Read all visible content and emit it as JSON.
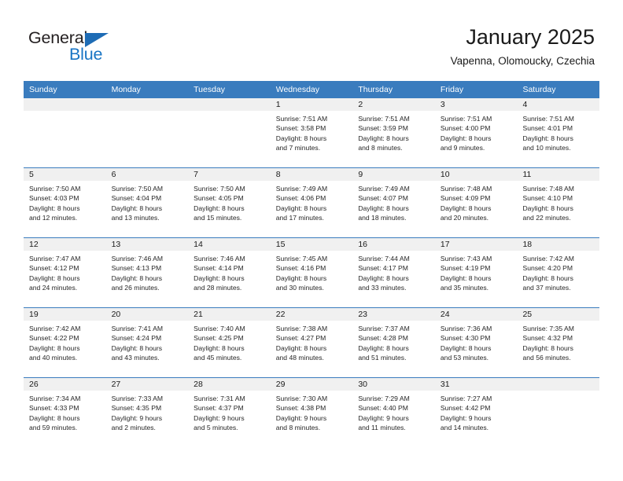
{
  "brand": {
    "name_part1": "General",
    "name_part2": "Blue",
    "color_dark": "#231f20",
    "color_blue": "#1874c4",
    "triangle_icon": "triangle-icon"
  },
  "header": {
    "title": "January 2025",
    "subtitle": "Vapenna, Olomoucky, Czechia"
  },
  "theme": {
    "header_band": "#3a7cbe",
    "day_strip": "#f0f0f0",
    "text": "#262626"
  },
  "weekdays": [
    "Sunday",
    "Monday",
    "Tuesday",
    "Wednesday",
    "Thursday",
    "Friday",
    "Saturday"
  ],
  "weeks": [
    [
      {
        "day": "",
        "empty": true,
        "sunrise": "",
        "sunset": "",
        "daylight1": "",
        "daylight2": ""
      },
      {
        "day": "",
        "empty": true,
        "sunrise": "",
        "sunset": "",
        "daylight1": "",
        "daylight2": ""
      },
      {
        "day": "",
        "empty": true,
        "sunrise": "",
        "sunset": "",
        "daylight1": "",
        "daylight2": ""
      },
      {
        "day": "1",
        "empty": false,
        "sunrise": "Sunrise: 7:51 AM",
        "sunset": "Sunset: 3:58 PM",
        "daylight1": "Daylight: 8 hours",
        "daylight2": "and 7 minutes."
      },
      {
        "day": "2",
        "empty": false,
        "sunrise": "Sunrise: 7:51 AM",
        "sunset": "Sunset: 3:59 PM",
        "daylight1": "Daylight: 8 hours",
        "daylight2": "and 8 minutes."
      },
      {
        "day": "3",
        "empty": false,
        "sunrise": "Sunrise: 7:51 AM",
        "sunset": "Sunset: 4:00 PM",
        "daylight1": "Daylight: 8 hours",
        "daylight2": "and 9 minutes."
      },
      {
        "day": "4",
        "empty": false,
        "sunrise": "Sunrise: 7:51 AM",
        "sunset": "Sunset: 4:01 PM",
        "daylight1": "Daylight: 8 hours",
        "daylight2": "and 10 minutes."
      }
    ],
    [
      {
        "day": "5",
        "empty": false,
        "sunrise": "Sunrise: 7:50 AM",
        "sunset": "Sunset: 4:03 PM",
        "daylight1": "Daylight: 8 hours",
        "daylight2": "and 12 minutes."
      },
      {
        "day": "6",
        "empty": false,
        "sunrise": "Sunrise: 7:50 AM",
        "sunset": "Sunset: 4:04 PM",
        "daylight1": "Daylight: 8 hours",
        "daylight2": "and 13 minutes."
      },
      {
        "day": "7",
        "empty": false,
        "sunrise": "Sunrise: 7:50 AM",
        "sunset": "Sunset: 4:05 PM",
        "daylight1": "Daylight: 8 hours",
        "daylight2": "and 15 minutes."
      },
      {
        "day": "8",
        "empty": false,
        "sunrise": "Sunrise: 7:49 AM",
        "sunset": "Sunset: 4:06 PM",
        "daylight1": "Daylight: 8 hours",
        "daylight2": "and 17 minutes."
      },
      {
        "day": "9",
        "empty": false,
        "sunrise": "Sunrise: 7:49 AM",
        "sunset": "Sunset: 4:07 PM",
        "daylight1": "Daylight: 8 hours",
        "daylight2": "and 18 minutes."
      },
      {
        "day": "10",
        "empty": false,
        "sunrise": "Sunrise: 7:48 AM",
        "sunset": "Sunset: 4:09 PM",
        "daylight1": "Daylight: 8 hours",
        "daylight2": "and 20 minutes."
      },
      {
        "day": "11",
        "empty": false,
        "sunrise": "Sunrise: 7:48 AM",
        "sunset": "Sunset: 4:10 PM",
        "daylight1": "Daylight: 8 hours",
        "daylight2": "and 22 minutes."
      }
    ],
    [
      {
        "day": "12",
        "empty": false,
        "sunrise": "Sunrise: 7:47 AM",
        "sunset": "Sunset: 4:12 PM",
        "daylight1": "Daylight: 8 hours",
        "daylight2": "and 24 minutes."
      },
      {
        "day": "13",
        "empty": false,
        "sunrise": "Sunrise: 7:46 AM",
        "sunset": "Sunset: 4:13 PM",
        "daylight1": "Daylight: 8 hours",
        "daylight2": "and 26 minutes."
      },
      {
        "day": "14",
        "empty": false,
        "sunrise": "Sunrise: 7:46 AM",
        "sunset": "Sunset: 4:14 PM",
        "daylight1": "Daylight: 8 hours",
        "daylight2": "and 28 minutes."
      },
      {
        "day": "15",
        "empty": false,
        "sunrise": "Sunrise: 7:45 AM",
        "sunset": "Sunset: 4:16 PM",
        "daylight1": "Daylight: 8 hours",
        "daylight2": "and 30 minutes."
      },
      {
        "day": "16",
        "empty": false,
        "sunrise": "Sunrise: 7:44 AM",
        "sunset": "Sunset: 4:17 PM",
        "daylight1": "Daylight: 8 hours",
        "daylight2": "and 33 minutes."
      },
      {
        "day": "17",
        "empty": false,
        "sunrise": "Sunrise: 7:43 AM",
        "sunset": "Sunset: 4:19 PM",
        "daylight1": "Daylight: 8 hours",
        "daylight2": "and 35 minutes."
      },
      {
        "day": "18",
        "empty": false,
        "sunrise": "Sunrise: 7:42 AM",
        "sunset": "Sunset: 4:20 PM",
        "daylight1": "Daylight: 8 hours",
        "daylight2": "and 37 minutes."
      }
    ],
    [
      {
        "day": "19",
        "empty": false,
        "sunrise": "Sunrise: 7:42 AM",
        "sunset": "Sunset: 4:22 PM",
        "daylight1": "Daylight: 8 hours",
        "daylight2": "and 40 minutes."
      },
      {
        "day": "20",
        "empty": false,
        "sunrise": "Sunrise: 7:41 AM",
        "sunset": "Sunset: 4:24 PM",
        "daylight1": "Daylight: 8 hours",
        "daylight2": "and 43 minutes."
      },
      {
        "day": "21",
        "empty": false,
        "sunrise": "Sunrise: 7:40 AM",
        "sunset": "Sunset: 4:25 PM",
        "daylight1": "Daylight: 8 hours",
        "daylight2": "and 45 minutes."
      },
      {
        "day": "22",
        "empty": false,
        "sunrise": "Sunrise: 7:38 AM",
        "sunset": "Sunset: 4:27 PM",
        "daylight1": "Daylight: 8 hours",
        "daylight2": "and 48 minutes."
      },
      {
        "day": "23",
        "empty": false,
        "sunrise": "Sunrise: 7:37 AM",
        "sunset": "Sunset: 4:28 PM",
        "daylight1": "Daylight: 8 hours",
        "daylight2": "and 51 minutes."
      },
      {
        "day": "24",
        "empty": false,
        "sunrise": "Sunrise: 7:36 AM",
        "sunset": "Sunset: 4:30 PM",
        "daylight1": "Daylight: 8 hours",
        "daylight2": "and 53 minutes."
      },
      {
        "day": "25",
        "empty": false,
        "sunrise": "Sunrise: 7:35 AM",
        "sunset": "Sunset: 4:32 PM",
        "daylight1": "Daylight: 8 hours",
        "daylight2": "and 56 minutes."
      }
    ],
    [
      {
        "day": "26",
        "empty": false,
        "sunrise": "Sunrise: 7:34 AM",
        "sunset": "Sunset: 4:33 PM",
        "daylight1": "Daylight: 8 hours",
        "daylight2": "and 59 minutes."
      },
      {
        "day": "27",
        "empty": false,
        "sunrise": "Sunrise: 7:33 AM",
        "sunset": "Sunset: 4:35 PM",
        "daylight1": "Daylight: 9 hours",
        "daylight2": "and 2 minutes."
      },
      {
        "day": "28",
        "empty": false,
        "sunrise": "Sunrise: 7:31 AM",
        "sunset": "Sunset: 4:37 PM",
        "daylight1": "Daylight: 9 hours",
        "daylight2": "and 5 minutes."
      },
      {
        "day": "29",
        "empty": false,
        "sunrise": "Sunrise: 7:30 AM",
        "sunset": "Sunset: 4:38 PM",
        "daylight1": "Daylight: 9 hours",
        "daylight2": "and 8 minutes."
      },
      {
        "day": "30",
        "empty": false,
        "sunrise": "Sunrise: 7:29 AM",
        "sunset": "Sunset: 4:40 PM",
        "daylight1": "Daylight: 9 hours",
        "daylight2": "and 11 minutes."
      },
      {
        "day": "31",
        "empty": false,
        "sunrise": "Sunrise: 7:27 AM",
        "sunset": "Sunset: 4:42 PM",
        "daylight1": "Daylight: 9 hours",
        "daylight2": "and 14 minutes."
      },
      {
        "day": "",
        "empty": true,
        "sunrise": "",
        "sunset": "",
        "daylight1": "",
        "daylight2": ""
      }
    ]
  ]
}
